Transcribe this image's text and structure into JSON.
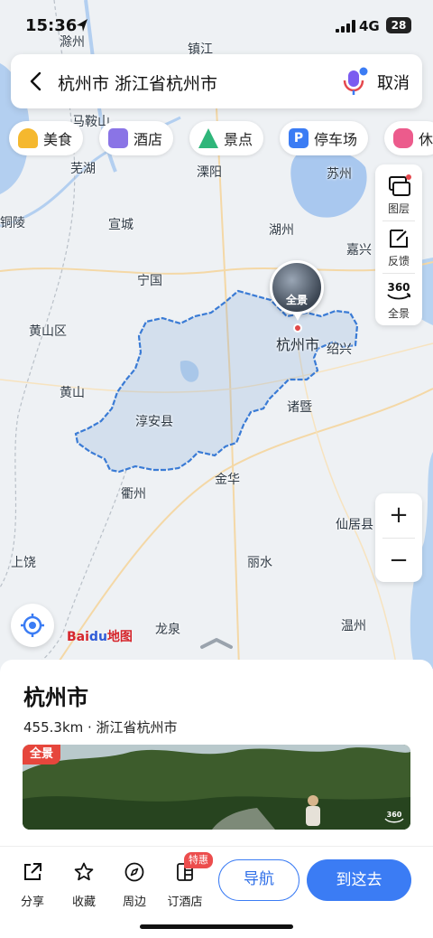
{
  "status_bar": {
    "time": "15:36",
    "network": "4G",
    "battery": "28"
  },
  "search": {
    "query": "杭州市 浙江省杭州市",
    "cancel_label": "取消"
  },
  "chips": [
    {
      "label": "美食",
      "icon": "food-icon",
      "color": "#f5b82e"
    },
    {
      "label": "酒店",
      "icon": "hotel-icon",
      "color": "#8a74e6"
    },
    {
      "label": "景点",
      "icon": "scenic-icon",
      "color": "#2fb67a"
    },
    {
      "label": "停车场",
      "icon": "parking-icon",
      "color": "#3b7cf4"
    },
    {
      "label": "休",
      "icon": "leisure-icon",
      "color": "#ec5b8c"
    }
  ],
  "map_tools": [
    {
      "label": "图层",
      "icon": "layers-icon"
    },
    {
      "label": "反馈",
      "icon": "feedback-icon"
    },
    {
      "label": "全景",
      "icon": "panorama-360-icon"
    }
  ],
  "zoom": {
    "in": "+",
    "out": "−"
  },
  "map": {
    "labels": [
      "滁州",
      "镇江",
      "马鞍山",
      "芜湖",
      "溧阳",
      "苏州",
      "铜陵",
      "宣城",
      "湖州",
      "嘉兴",
      "宁国",
      "黄山区",
      "杭州市",
      "绍兴",
      "黄山",
      "淳安县",
      "诸暨",
      "衢州",
      "金华",
      "仙居县",
      "上饶",
      "丽水",
      "龙泉",
      "温州"
    ],
    "pano_label": "全景",
    "boundary_color": "#3a7bd5",
    "logo": {
      "part1": "Bai",
      "part2": "du",
      "part3": "地图"
    }
  },
  "place": {
    "name": "杭州市",
    "meta": "455.3km · 浙江省杭州市",
    "photo_badge": "全景"
  },
  "bottom_bar": {
    "share": "分享",
    "favorite": "收藏",
    "nearby": "周边",
    "hotel": "订酒店",
    "hotel_badge": "特惠",
    "navigate": "导航",
    "go": "到这去"
  }
}
